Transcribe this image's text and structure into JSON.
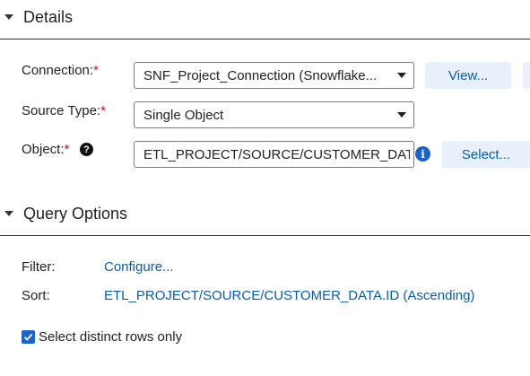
{
  "details": {
    "title": "Details",
    "connection": {
      "label": "Connection:",
      "required": "*",
      "value": "SNF_Project_Connection (Snowflake...",
      "view_button": "View..."
    },
    "source_type": {
      "label": "Source Type:",
      "required": "*",
      "value": "Single Object"
    },
    "object": {
      "label": "Object:",
      "required": "*",
      "help": "?",
      "value": "ETL_PROJECT/SOURCE/CUSTOMER_DATA",
      "info": "i",
      "select_button": "Select..."
    }
  },
  "query_options": {
    "title": "Query Options",
    "filter": {
      "label": "Filter:",
      "link": "Configure..."
    },
    "sort": {
      "label": "Sort:",
      "link": "ETL_PROJECT/SOURCE/CUSTOMER_DATA.ID (Ascending)"
    },
    "distinct": {
      "label": "Select distinct rows only",
      "checked": true
    }
  }
}
